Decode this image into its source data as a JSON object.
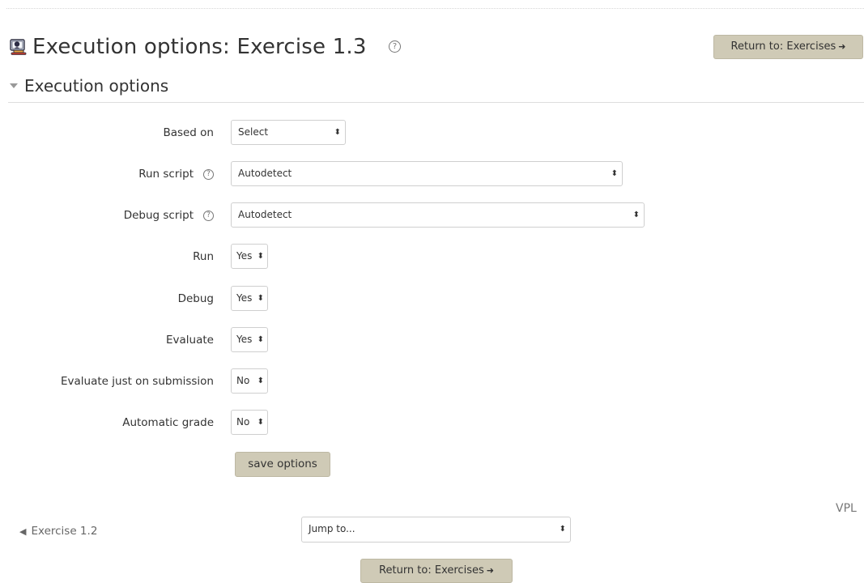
{
  "header": {
    "title": "Execution options: Exercise 1.3",
    "help_glyph": "?",
    "return_button": "Return to: Exercises",
    "page_icon": "vpl-activity-icon"
  },
  "section": {
    "title": "Execution options",
    "collapse_icon": "chevron-down-icon"
  },
  "form": {
    "fields": [
      {
        "label": "Based on",
        "value": "Select",
        "has_help": false
      },
      {
        "label": "Run script",
        "value": "Autodetect",
        "has_help": true
      },
      {
        "label": "Debug script",
        "value": "Autodetect",
        "has_help": true
      },
      {
        "label": "Run",
        "value": "Yes",
        "has_help": false
      },
      {
        "label": "Debug",
        "value": "Yes",
        "has_help": false
      },
      {
        "label": "Evaluate",
        "value": "Yes",
        "has_help": false
      },
      {
        "label": "Evaluate just on submission",
        "value": "No",
        "has_help": false
      },
      {
        "label": "Automatic grade",
        "value": "No",
        "has_help": false
      }
    ],
    "help_glyph": "?",
    "select_arrows": "⬍",
    "save_button": "save options"
  },
  "footer": {
    "vpl_label": "VPL",
    "prev_link": "Exercise 1.2",
    "prev_icon": "◀",
    "jump_to": "Jump to...",
    "return_button": "Return to: Exercises"
  },
  "colors": {
    "button_bg": "#cfcab6",
    "text": "#333333",
    "muted": "#777777"
  }
}
